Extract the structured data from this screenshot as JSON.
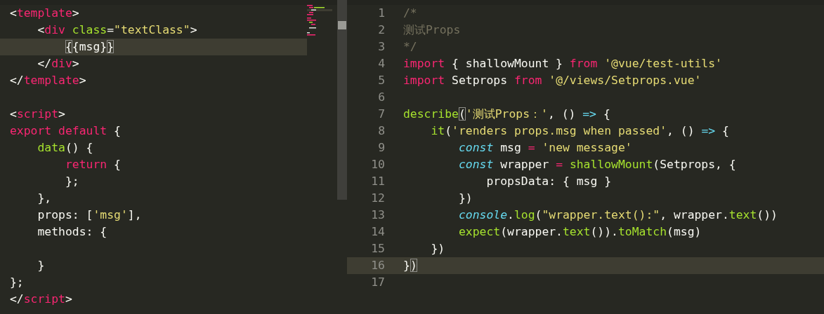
{
  "left_editor": {
    "lines": [
      {
        "current": false,
        "tokens": [
          {
            "kind": "plain",
            "text": "<"
          },
          {
            "kind": "tag",
            "text": "template"
          },
          {
            "kind": "plain",
            "text": ">"
          }
        ]
      },
      {
        "current": false,
        "tokens": [
          {
            "kind": "plain",
            "text": "    <"
          },
          {
            "kind": "tag",
            "text": "div"
          },
          {
            "kind": "attr",
            "text": " class"
          },
          {
            "kind": "plain",
            "text": "="
          },
          {
            "kind": "string",
            "text": "\"textClass\""
          },
          {
            "kind": "plain",
            "text": ">"
          }
        ]
      },
      {
        "current": true,
        "tokens": [
          {
            "kind": "match",
            "text": "        {"
          },
          {
            "kind": "plain",
            "text": "{msg}"
          },
          {
            "kind": "match",
            "text": "}"
          }
        ]
      },
      {
        "current": false,
        "tokens": [
          {
            "kind": "plain",
            "text": "    </"
          },
          {
            "kind": "tag",
            "text": "div"
          },
          {
            "kind": "plain",
            "text": ">"
          }
        ]
      },
      {
        "current": false,
        "tokens": [
          {
            "kind": "plain",
            "text": "</"
          },
          {
            "kind": "tag",
            "text": "template"
          },
          {
            "kind": "plain",
            "text": ">"
          }
        ]
      },
      {
        "current": false
      },
      {
        "current": false,
        "tokens": [
          {
            "kind": "plain",
            "text": "<"
          },
          {
            "kind": "tag",
            "text": "script"
          },
          {
            "kind": "plain",
            "text": ">"
          }
        ]
      },
      {
        "current": false,
        "tokens": [
          {
            "kind": "keyword",
            "text": "export"
          },
          {
            "kind": "keyword",
            "text": " default"
          },
          {
            "kind": "plain",
            "text": " {"
          }
        ]
      },
      {
        "current": false,
        "tokens": [
          {
            "kind": "function",
            "text": "    data"
          },
          {
            "kind": "plain",
            "text": "() {"
          }
        ]
      },
      {
        "current": false,
        "tokens": [
          {
            "kind": "keyword",
            "text": "        return"
          },
          {
            "kind": "plain",
            "text": " {"
          }
        ]
      },
      {
        "current": false,
        "tokens": [
          {
            "kind": "plain",
            "text": "        };"
          }
        ]
      },
      {
        "current": false,
        "tokens": [
          {
            "kind": "plain",
            "text": "    },"
          }
        ]
      },
      {
        "current": false,
        "tokens": [
          {
            "kind": "plain",
            "text": "    props: ["
          },
          {
            "kind": "string",
            "text": "'msg'"
          },
          {
            "kind": "plain",
            "text": "],"
          }
        ]
      },
      {
        "current": false,
        "tokens": [
          {
            "kind": "plain",
            "text": "    methods: {"
          }
        ]
      },
      {
        "current": false
      },
      {
        "current": false,
        "tokens": [
          {
            "kind": "plain",
            "text": "    }"
          }
        ]
      },
      {
        "current": false,
        "tokens": [
          {
            "kind": "plain",
            "text": "};"
          }
        ]
      },
      {
        "current": false,
        "tokens": [
          {
            "kind": "plain",
            "text": "</"
          },
          {
            "kind": "tag",
            "text": "script"
          },
          {
            "kind": "plain",
            "text": ">"
          }
        ]
      }
    ]
  },
  "right_editor": {
    "lines": [
      {
        "number": "1",
        "current": false,
        "tokens": [
          {
            "kind": "comment",
            "text": "/*"
          }
        ]
      },
      {
        "number": "2",
        "current": false,
        "tokens": [
          {
            "kind": "comment",
            "text": "测试Props"
          }
        ]
      },
      {
        "number": "3",
        "current": false,
        "tokens": [
          {
            "kind": "comment",
            "text": "*/"
          }
        ]
      },
      {
        "number": "4",
        "current": false,
        "tokens": [
          {
            "kind": "keyword",
            "text": "import"
          },
          {
            "kind": "plain",
            "text": " { shallowMount } "
          },
          {
            "kind": "keyword",
            "text": "from"
          },
          {
            "kind": "string",
            "text": " '@vue/test-utils'"
          }
        ]
      },
      {
        "number": "5",
        "current": false,
        "tokens": [
          {
            "kind": "keyword",
            "text": "import"
          },
          {
            "kind": "plain",
            "text": " Setprops "
          },
          {
            "kind": "keyword",
            "text": "from"
          },
          {
            "kind": "string",
            "text": " '@/views/Setprops.vue'"
          }
        ]
      },
      {
        "number": "6",
        "current": false
      },
      {
        "number": "7",
        "current": false,
        "tokens": [
          {
            "kind": "function",
            "text": "describe"
          },
          {
            "kind": "match",
            "text": "("
          },
          {
            "kind": "string",
            "text": "'测试Props：'"
          },
          {
            "kind": "plain",
            "text": ", () "
          },
          {
            "kind": "operator",
            "text": "=>"
          },
          {
            "kind": "plain",
            "text": " {"
          }
        ]
      },
      {
        "number": "8",
        "current": false,
        "tokens": [
          {
            "kind": "function",
            "text": "    it"
          },
          {
            "kind": "plain",
            "text": "("
          },
          {
            "kind": "string",
            "text": "'renders props.msg when passed'"
          },
          {
            "kind": "plain",
            "text": ", () "
          },
          {
            "kind": "operator",
            "text": "=>"
          },
          {
            "kind": "plain",
            "text": " {"
          }
        ]
      },
      {
        "number": "9",
        "current": false,
        "tokens": [
          {
            "kind": "storage",
            "text": "        const"
          },
          {
            "kind": "plain",
            "text": " msg "
          },
          {
            "kind": "keyword",
            "text": "="
          },
          {
            "kind": "string",
            "text": " 'new message'"
          }
        ]
      },
      {
        "number": "10",
        "current": false,
        "tokens": [
          {
            "kind": "storage",
            "text": "        const"
          },
          {
            "kind": "plain",
            "text": " wrapper "
          },
          {
            "kind": "keyword",
            "text": "="
          },
          {
            "kind": "function",
            "text": " shallowMount"
          },
          {
            "kind": "plain",
            "text": "(Setprops, {"
          }
        ]
      },
      {
        "number": "11",
        "current": false,
        "tokens": [
          {
            "kind": "plain",
            "text": "            propsData: { msg }"
          }
        ]
      },
      {
        "number": "12",
        "current": false,
        "tokens": [
          {
            "kind": "plain",
            "text": "        })"
          }
        ]
      },
      {
        "number": "13",
        "current": false,
        "tokens": [
          {
            "kind": "storage",
            "text": "        console"
          },
          {
            "kind": "plain",
            "text": "."
          },
          {
            "kind": "function",
            "text": "log"
          },
          {
            "kind": "plain",
            "text": "("
          },
          {
            "kind": "string",
            "text": "\"wrapper.text():\""
          },
          {
            "kind": "plain",
            "text": ", wrapper."
          },
          {
            "kind": "function",
            "text": "text"
          },
          {
            "kind": "plain",
            "text": "())"
          }
        ]
      },
      {
        "number": "14",
        "current": false,
        "tokens": [
          {
            "kind": "function",
            "text": "        expect"
          },
          {
            "kind": "plain",
            "text": "(wrapper."
          },
          {
            "kind": "function",
            "text": "text"
          },
          {
            "kind": "plain",
            "text": "())."
          },
          {
            "kind": "function",
            "text": "toMatch"
          },
          {
            "kind": "plain",
            "text": "(msg)"
          }
        ]
      },
      {
        "number": "15",
        "current": false,
        "tokens": [
          {
            "kind": "plain",
            "text": "    })"
          }
        ]
      },
      {
        "number": "16",
        "current": true,
        "tokens": [
          {
            "kind": "plain",
            "text": "}"
          },
          {
            "kind": "match",
            "text": ")"
          }
        ]
      },
      {
        "number": "17",
        "current": false
      }
    ]
  }
}
